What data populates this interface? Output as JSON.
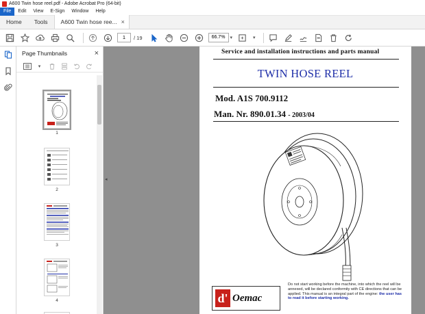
{
  "window": {
    "title": "A600 Twin hose reel.pdf - Adobe Acrobat Pro (64-bit)"
  },
  "menu": {
    "items": [
      "File",
      "Edit",
      "View",
      "E-Sign",
      "Window",
      "Help"
    ]
  },
  "tabs": {
    "home": "Home",
    "tools": "Tools",
    "document": "A600 Twin hose ree...",
    "close": "×"
  },
  "toolbar": {
    "current_page": "1",
    "total_pages": "/ 19",
    "zoom": "66.7%",
    "icons": [
      "save-icon",
      "bookmark-star-icon",
      "upload-icon",
      "print-icon",
      "search-icon",
      "page-up-icon",
      "page-down-icon",
      "select-cursor-icon",
      "hand-icon",
      "zoom-out-icon",
      "zoom-in-icon",
      "fit-page-icon",
      "comment-icon",
      "pen-icon",
      "sign-icon",
      "redact-icon",
      "delete-icon",
      "share-icon"
    ]
  },
  "panel": {
    "title": "Page Thumbnails",
    "close": "×"
  },
  "thumbnails": [
    {
      "label": "1"
    },
    {
      "label": "2"
    },
    {
      "label": "3"
    },
    {
      "label": "4"
    }
  ],
  "document_page": {
    "header": "Service and installation instructions and parts manual",
    "title": "TWIN HOSE REEL",
    "model": "Mod.  A1S 700.9112",
    "man_nr": "Man. Nr. 890.01.34",
    "man_date": "- 2003/04",
    "logo_mark": "d'",
    "logo_word": "Oemac",
    "notice_normal": "Do not start working before the machine, into which the reel will be annexed, will be declared conformity with CE directions that can be applied. This manual is an integral part of the engine: ",
    "notice_emphasis": "the user has to read it before starting working."
  }
}
